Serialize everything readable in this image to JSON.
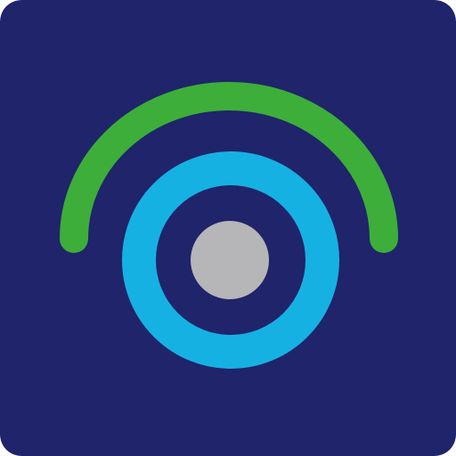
{
  "icon": {
    "name": "wireless-camera-app-icon",
    "colors": {
      "background": "#20246A",
      "signal_arc": "#3DAE3A",
      "lens_ring": "#16B1E3",
      "lens_center": "#B6B6B8"
    }
  }
}
